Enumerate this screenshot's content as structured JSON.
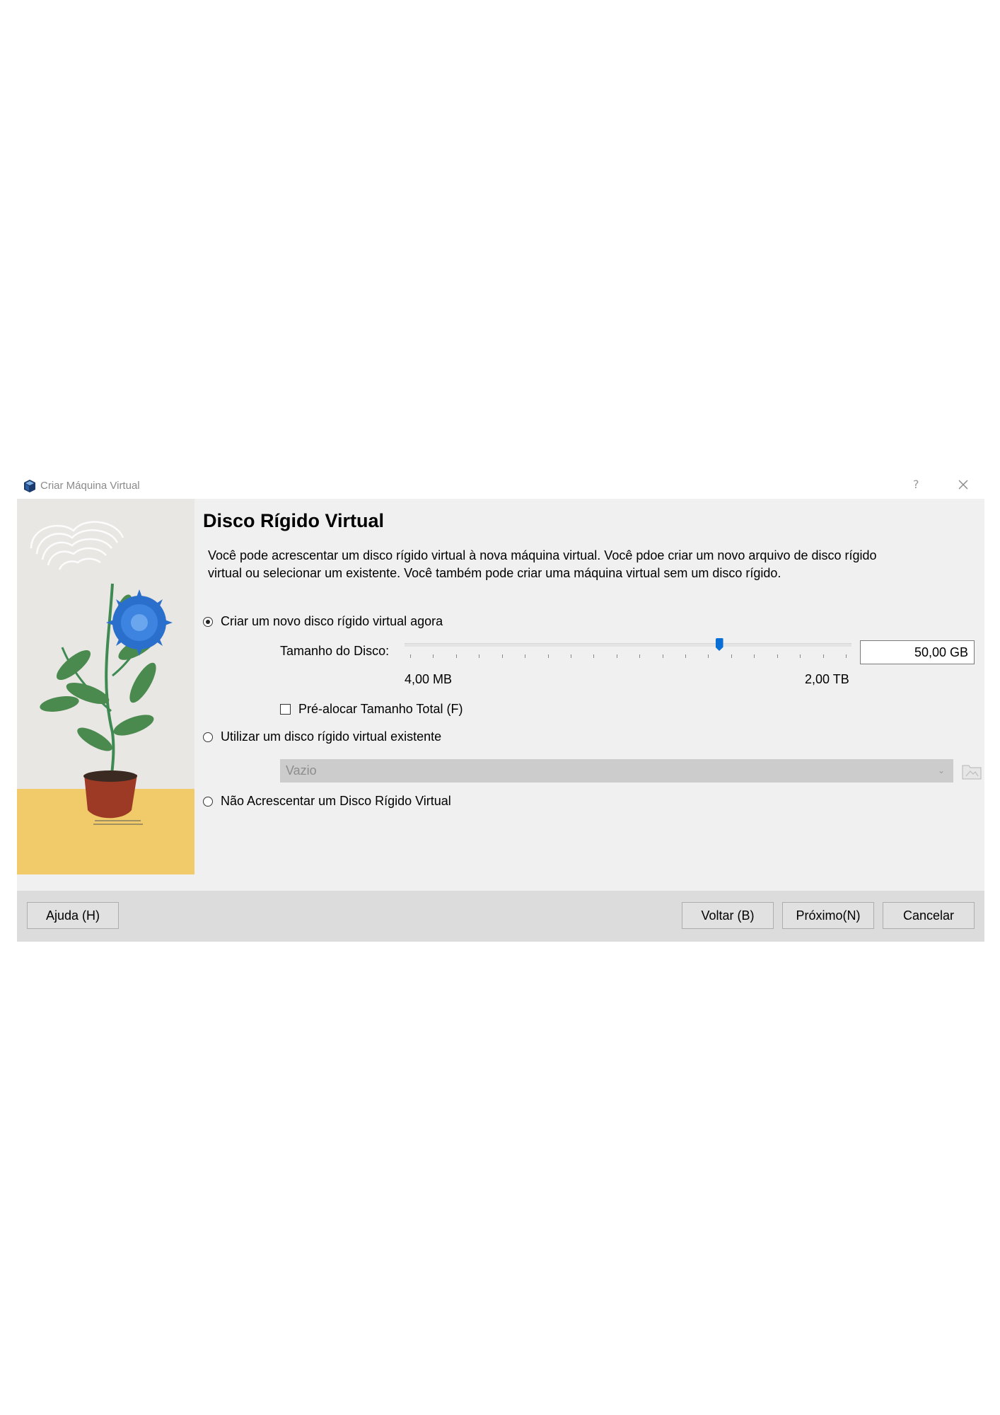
{
  "window": {
    "title": "Criar Máquina Virtual",
    "help_glyph": "?",
    "app_icon": "virtualbox-icon"
  },
  "page": {
    "title": "Disco Rígido Virtual",
    "description": "Você pode acrescentar um disco rígido virtual à nova máquina virtual. Você pdoe criar um novo arquivo de disco rígido virtual ou selecionar um existente. Você também pode criar uma máquina virtual sem um disco rígido."
  },
  "options": {
    "create_new": {
      "label": "Criar um novo disco rígido virtual agora",
      "checked": true
    },
    "use_existing": {
      "label": "Utilizar um disco rígido virtual existente",
      "checked": false
    },
    "none": {
      "label": "Não Acrescentar um Disco Rígido Virtual",
      "checked": false
    }
  },
  "disk_size": {
    "label": "Tamanho do Disco:",
    "min_label": "4,00 MB",
    "max_label": "2,00 TB",
    "value": "50,00 GB",
    "slider_fraction": 0.705
  },
  "prealloc": {
    "label": "Pré-alocar Tamanho Total (F)",
    "checked": false
  },
  "existing_disk": {
    "selected": "Vazio",
    "disabled": true
  },
  "buttons": {
    "help": "Ajuda (H)",
    "back": "Voltar (B)",
    "next": "Próximo(N)",
    "cancel": "Cancelar"
  },
  "colors": {
    "accent": "#0a6fd4",
    "dialog_bg": "#f0f0f0",
    "footer_bg": "#dcdcdc"
  }
}
